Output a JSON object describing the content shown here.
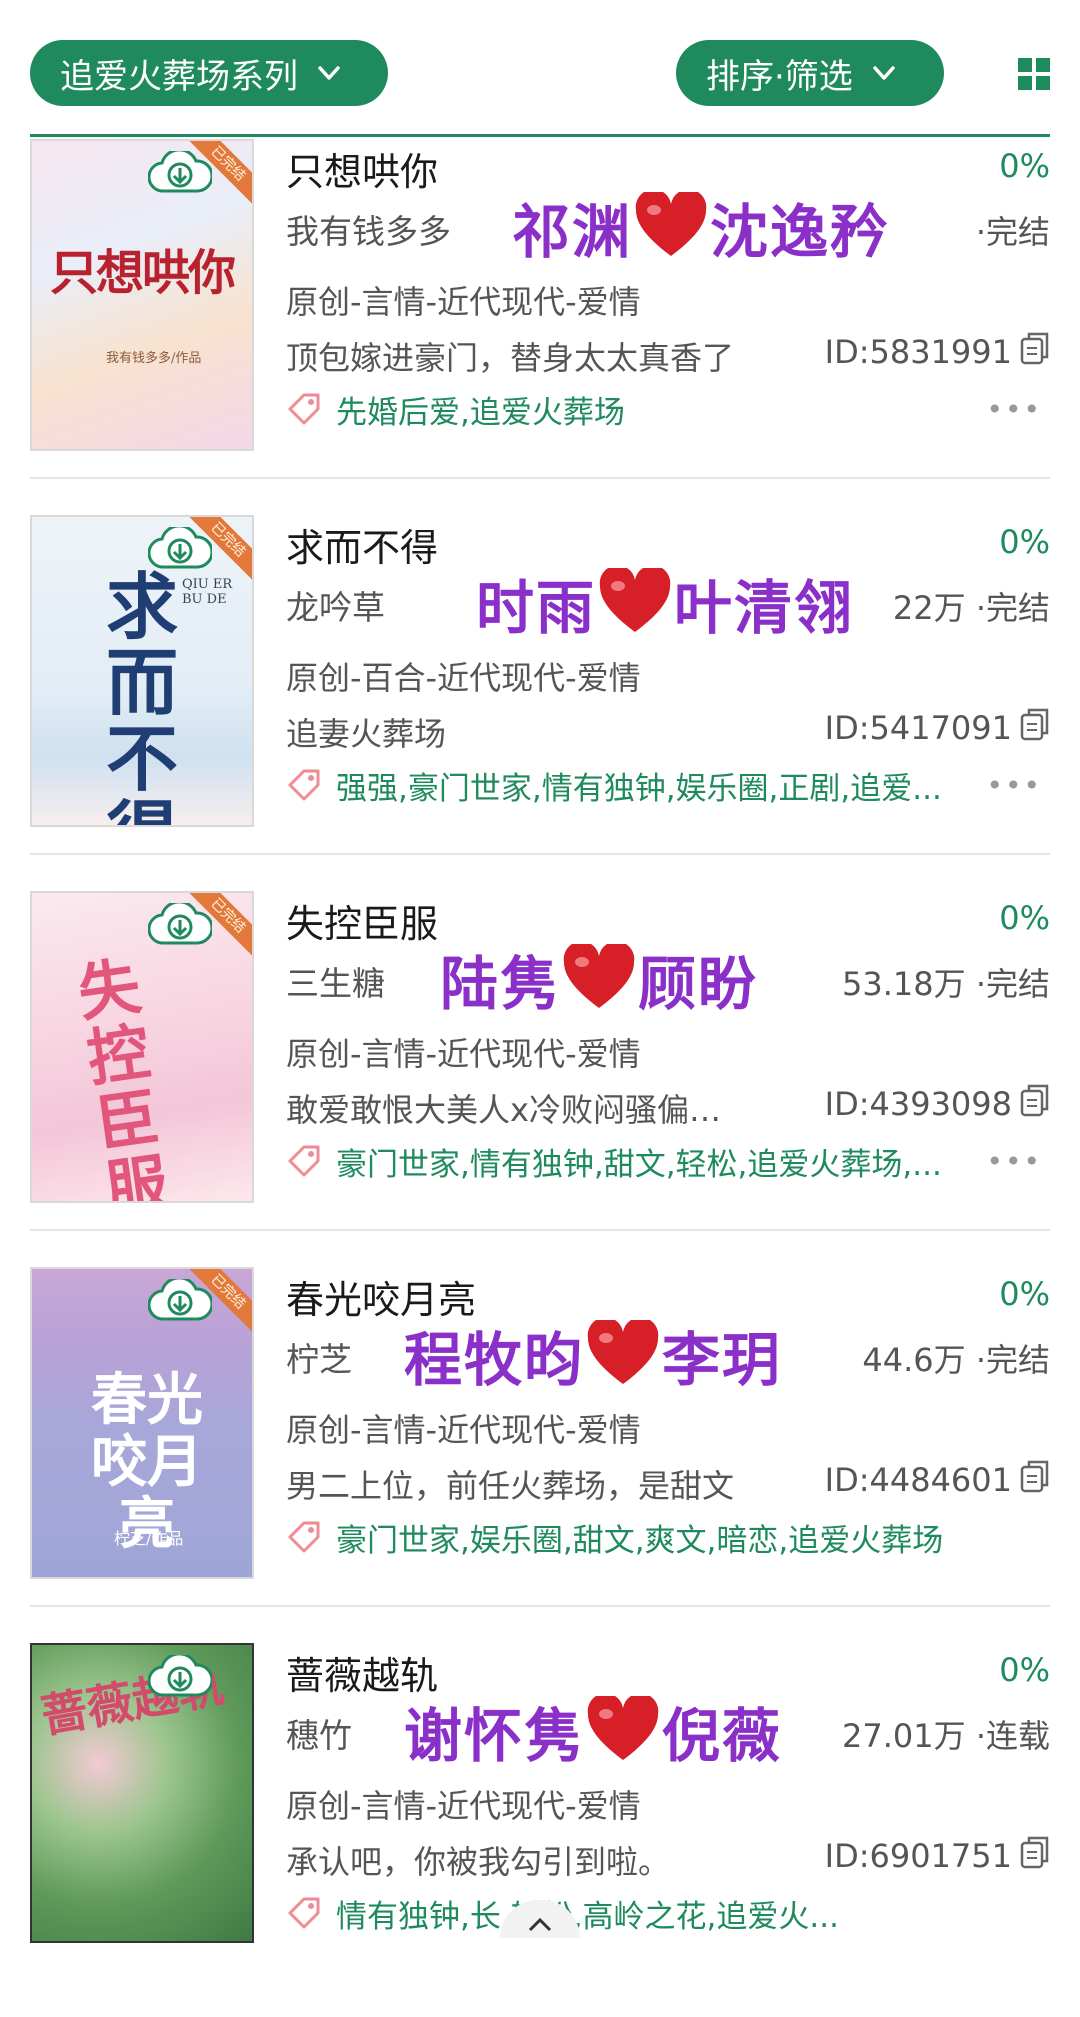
{
  "toolbar": {
    "series_filter": "追爱火葬场系列",
    "sort_filter": "排序·筛选",
    "colors": {
      "accent": "#1e8a5e",
      "overlay_text": "#8b2fc9",
      "heart": "#d61f26"
    }
  },
  "books": [
    {
      "title": "只想哄你",
      "progress": "0%",
      "author": "我有钱多多",
      "words": "",
      "status": "·完结",
      "category": "原创-言情-近代现代-爱情",
      "summary": "顶包嫁进豪门，替身太太真香了",
      "id": "ID:5831991",
      "tags": "先婚后爱,追爱火葬场",
      "cover_title": "只想哄你",
      "cover_sub": "我有钱多多/作品",
      "pair_left": "祁渊",
      "pair_right": "沈逸矜"
    },
    {
      "title": "求而不得",
      "progress": "0%",
      "author": "龙吟草",
      "words": "22万",
      "status": "·完结",
      "category": "原创-百合-近代现代-爱情",
      "summary": "追妻火葬场",
      "id": "ID:5417091",
      "tags": "强强,豪门世家,情有独钟,娱乐圈,正剧,追爱...",
      "cover_title": "求而不得",
      "cover_sub": "QIU ER BU DE",
      "pair_left": "时雨",
      "pair_right": "叶清翎"
    },
    {
      "title": "失控臣服",
      "progress": "0%",
      "author": "三生糖",
      "words": "53.18万",
      "status": "·完结",
      "category": "原创-言情-近代现代-爱情",
      "summary": "敢爱敢恨大美人x冷败闷骚偏…",
      "id": "ID:4393098",
      "tags": "豪门世家,情有独钟,甜文,轻松,追爱火葬场,...",
      "cover_title": "失控臣服",
      "cover_sub": "",
      "pair_left": "陆隽",
      "pair_right": "顾盼"
    },
    {
      "title": "春光咬月亮",
      "progress": "0%",
      "author": "柠芝",
      "words": "44.6万",
      "status": "·完结",
      "category": "原创-言情-近代现代-爱情",
      "summary": "男二上位，前任火葬场，是甜文",
      "id": "ID:4484601",
      "tags": "豪门世家,娱乐圈,甜文,爽文,暗恋,追爱火葬场",
      "cover_title": "春光咬月亮",
      "cover_sub": "柠芝/作品",
      "pair_left": "程牧昀",
      "pair_right": "李玥"
    },
    {
      "title": "蔷薇越轨",
      "progress": "0%",
      "author": "穗竹",
      "words": "27.01万",
      "status": "·连载",
      "category": "原创-言情-近代现代-爱情",
      "summary": "承认吧，你被我勾引到啦。",
      "id": "ID:6901751",
      "tags": "情有独钟,长,轻松,高岭之花,追爱火...",
      "cover_title": "蔷薇越轨",
      "cover_sub": "",
      "pair_left": "谢怀隽",
      "pair_right": "倪薇"
    }
  ],
  "ribbon_label": "已完结"
}
